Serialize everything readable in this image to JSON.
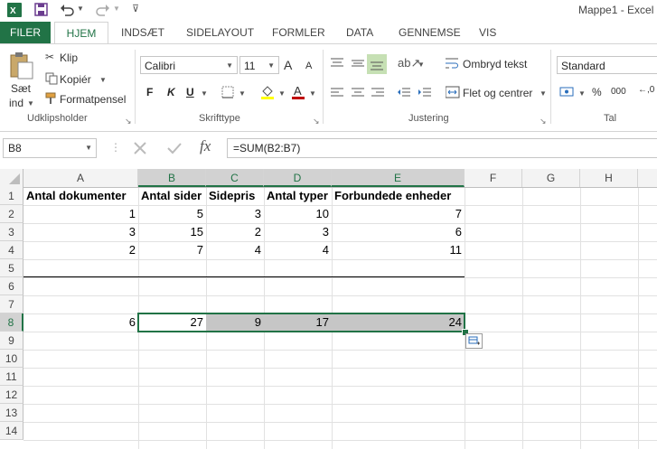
{
  "window": {
    "title": "Mappe1 - Excel"
  },
  "qat": {
    "icons": [
      "excel-logo-icon",
      "save-icon",
      "undo-icon",
      "redo-icon",
      "customize-icon"
    ]
  },
  "tabs": [
    {
      "label": "FILER"
    },
    {
      "label": "HJEM"
    },
    {
      "label": "INDSÆT"
    },
    {
      "label": "SIDELAYOUT"
    },
    {
      "label": "FORMLER"
    },
    {
      "label": "DATA"
    },
    {
      "label": "GENNEMSE"
    },
    {
      "label": "VIS"
    }
  ],
  "ribbon": {
    "clipboard": {
      "paste_label_1": "Sæt",
      "paste_label_2": "ind",
      "cut": "Klip",
      "copy": "Kopiér",
      "format_painter": "Formatpensel",
      "group": "Udklipsholder"
    },
    "font": {
      "name": "Calibri",
      "size": "11",
      "bold": "F",
      "italic": "K",
      "underline": "U",
      "grow": "A",
      "shrink": "A",
      "group": "Skrifttype"
    },
    "alignment": {
      "wrap": "Ombryd tekst",
      "merge": "Flet og centrer",
      "group": "Justering"
    },
    "number": {
      "format": "Standard",
      "percent": "%",
      "thousands": "000",
      "group": "Tal"
    }
  },
  "formula_bar": {
    "name_box": "B8",
    "fx": "fx",
    "formula": "=SUM(B2:B7)"
  },
  "columns": [
    "A",
    "B",
    "C",
    "D",
    "E",
    "F",
    "G",
    "H"
  ],
  "rows": [
    "1",
    "2",
    "3",
    "4",
    "5",
    "6",
    "7",
    "8",
    "9",
    "10",
    "11",
    "12",
    "13",
    "14"
  ],
  "cells": {
    "r1": [
      "Antal dokumenter",
      "Antal sider",
      "Sidepris",
      "Antal typer",
      "Forbundede enheder"
    ],
    "r2": [
      "1",
      "5",
      "3",
      "10",
      "7"
    ],
    "r3": [
      "3",
      "15",
      "2",
      "3",
      "6"
    ],
    "r4": [
      "2",
      "7",
      "4",
      "4",
      "11"
    ],
    "r8": [
      "6",
      "27",
      "9",
      "17",
      "24"
    ]
  },
  "colors": {
    "excel_green": "#217346",
    "selection_fill": "#c6c6c6"
  }
}
